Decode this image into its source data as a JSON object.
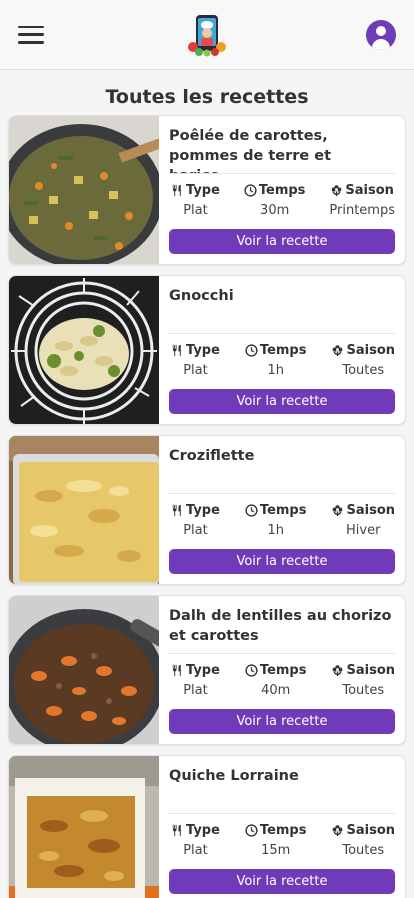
{
  "header": {
    "menu_icon": "hamburger-menu-icon",
    "logo_icon": "chef-phone-logo-icon",
    "profile_icon": "user-profile-icon",
    "accent_color": "#6f3bb9"
  },
  "page": {
    "title": "Toutes les recettes"
  },
  "labels": {
    "type": "Type",
    "time": "Temps",
    "season": "Saison",
    "button": "Voir la recette"
  },
  "recipes": [
    {
      "name": "Poêlée de carottes, pommes de terre et harico...",
      "type": "Plat",
      "time": "30m",
      "season": "Printemps"
    },
    {
      "name": "Gnocchi",
      "type": "Plat",
      "time": "1h",
      "season": "Toutes"
    },
    {
      "name": "Croziflette",
      "type": "Plat",
      "time": "1h",
      "season": "Hiver"
    },
    {
      "name": "Dalh de lentilles au chorizo et carottes",
      "type": "Plat",
      "time": "40m",
      "season": "Toutes"
    },
    {
      "name": "Quiche Lorraine",
      "type": "Plat",
      "time": "15m",
      "season": "Toutes"
    }
  ]
}
